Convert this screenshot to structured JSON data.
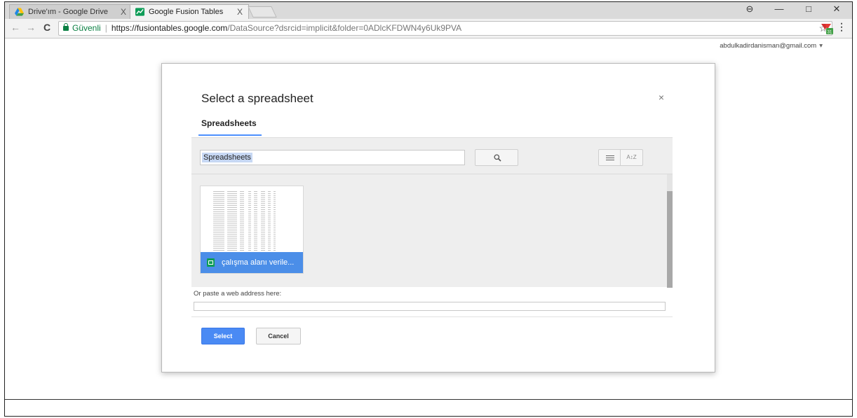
{
  "browser": {
    "tabs": [
      {
        "title": "Drive'ım - Google Drive",
        "close": "X",
        "icon": "google-drive-icon",
        "active": false
      },
      {
        "title": "Google Fusion Tables",
        "close": "X",
        "icon": "fusion-tables-icon",
        "active": true
      }
    ],
    "window_controls": {
      "account": "⊖",
      "minimize": "—",
      "restore": "□",
      "close": "✕"
    },
    "nav": {
      "back": "←",
      "forward": "→",
      "reload": "C"
    },
    "address": {
      "secure_label": "Güvenli",
      "separator": "|",
      "url_host": "https://fusiontables.google.com",
      "url_path": "/DataSource?dsrcid=implicit&folder=0ADlcKFDWN4y6Uk9PVA"
    },
    "bookmark_icon": "☆",
    "menu_icon": "⋮",
    "extension_badge": "31"
  },
  "account": {
    "email": "abdulkadirdanisman@gmail.com",
    "caret": "▾"
  },
  "dialog": {
    "title": "Select a spreadsheet",
    "close": "×",
    "tab_label": "Spreadsheets",
    "search": {
      "value": "Spreadsheets"
    },
    "sort_label": "A↕Z",
    "files": [
      {
        "name": "çalışma alanı verile..."
      }
    ],
    "paste_label": "Or paste a web address here:",
    "paste_value": "",
    "buttons": {
      "select": "Select",
      "cancel": "Cancel"
    }
  },
  "colors": {
    "primary_blue": "#4a8af4",
    "sheets_green": "#0f9d58",
    "secure_green": "#0b8043",
    "tab_underline": "#4d90fe"
  }
}
